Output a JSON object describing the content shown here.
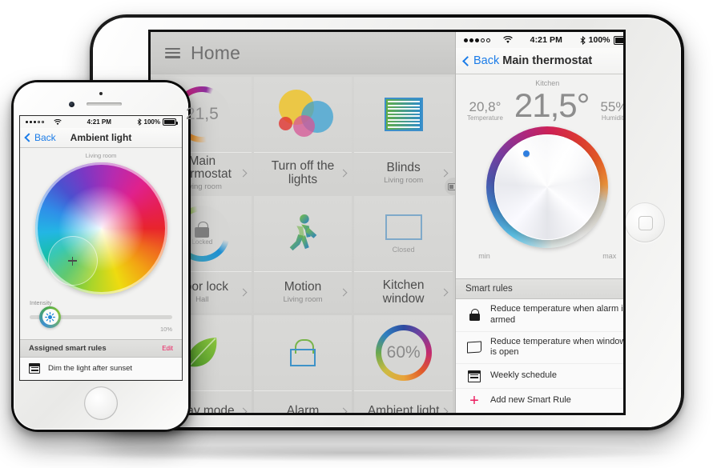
{
  "ipad": {
    "home": {
      "menu_icon": "hamburger-icon",
      "title": "Home",
      "tiles": [
        {
          "title": "Main thermostat",
          "subtitle": "Living room",
          "badge": "21,5",
          "icon": "thermostat-ring-icon"
        },
        {
          "title": "Turn off the lights",
          "subtitle": "",
          "badge": "",
          "icon": "light-bubbles-icon"
        },
        {
          "title": "Blinds",
          "subtitle": "Living room",
          "badge": "",
          "icon": "blinds-icon"
        },
        {
          "title": "Door lock",
          "subtitle": "Hall",
          "badge": "Locked",
          "icon": "padlock-ring-icon"
        },
        {
          "title": "Motion",
          "subtitle": "Living room",
          "badge": "",
          "icon": "walking-person-icon"
        },
        {
          "title": "Kitchen window",
          "subtitle": "",
          "badge": "Closed",
          "icon": "window-icon"
        },
        {
          "title": "Away mode",
          "subtitle": "",
          "badge": "",
          "icon": "leaf-icon"
        },
        {
          "title": "Alarm",
          "subtitle": "",
          "badge": "",
          "icon": "padlock-icon"
        },
        {
          "title": "Ambient light",
          "subtitle": "",
          "badge": "60%",
          "icon": "ambient-ring-icon"
        }
      ]
    },
    "detail": {
      "status": {
        "signal": "●●●○○",
        "wifi": "wifi-icon",
        "time": "4:21 PM",
        "bluetooth": "bluetooth-icon",
        "battery_pct": "100%"
      },
      "back_label": "Back",
      "nav_title": "Main thermostat",
      "room": "Kitchen",
      "left_readout": {
        "value": "20,8°",
        "label": "Temperature"
      },
      "main_value": "21,5°",
      "right_readout": {
        "value": "55%",
        "label": "Humidity"
      },
      "dial": {
        "min_label": "min",
        "max_label": "max"
      },
      "rules_header": "Smart rules",
      "rules": [
        {
          "text": "Reduce temperature when alarm is armed",
          "icon": "lock-icon"
        },
        {
          "text": "Reduce temperature when window is open",
          "icon": "window-icon"
        },
        {
          "text": "Weekly schedule",
          "icon": "calendar-icon"
        },
        {
          "text": "Add new Smart Rule",
          "icon": "plus-icon"
        }
      ]
    }
  },
  "iphone": {
    "status": {
      "signal": "●●●○○",
      "wifi": "wifi-icon",
      "time": "4:21 PM",
      "bluetooth": "bluetooth-icon",
      "battery_pct": "100%"
    },
    "back_label": "Back",
    "nav_title": "Ambient light",
    "room": "Living room",
    "color_wheel": {
      "icon": "color-wheel-picker"
    },
    "intensity": {
      "label": "Intensity",
      "value": "10%",
      "knob_icon": "brightness-icon"
    },
    "rules_header": "Assigned smart rules",
    "edit_label": "Edit",
    "rules": [
      {
        "text": "Dim the light after sunset",
        "icon": "calendar-icon"
      }
    ]
  },
  "colors": {
    "accent_blue": "#1b7ce8",
    "accent_pink": "#ec1c5e",
    "screen_bg": "#f2f2f1",
    "grid_bg": "#d6d6d4"
  }
}
